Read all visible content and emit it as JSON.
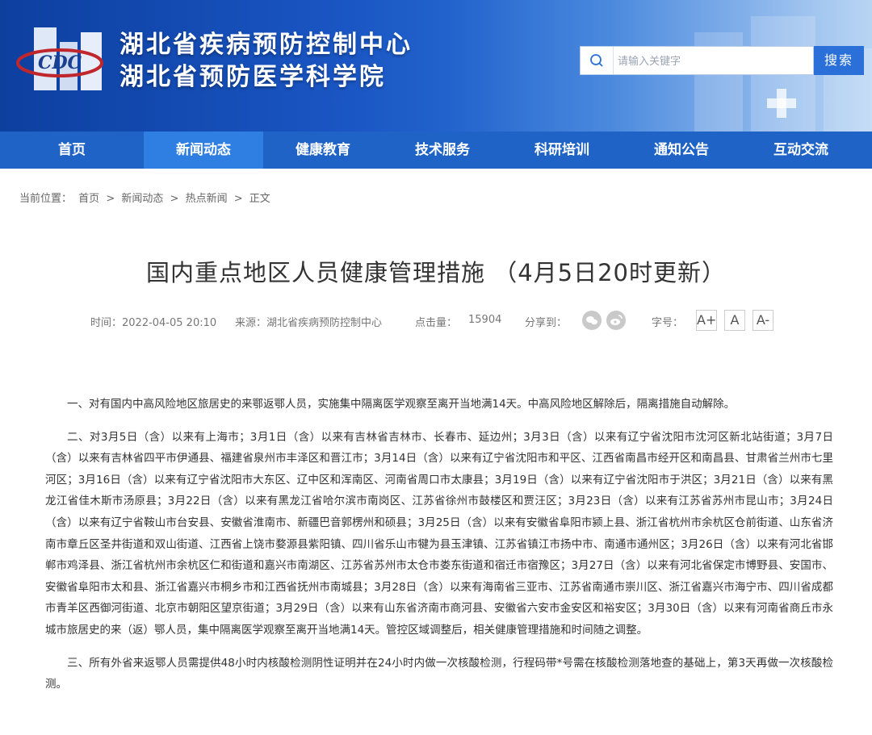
{
  "header": {
    "org_name_1": "湖北省疾病预防控制中心",
    "org_name_2": "湖北省预防医学科学院",
    "logo_text": "CDC"
  },
  "search": {
    "placeholder": "请输入关键字",
    "button": "搜索"
  },
  "nav": [
    {
      "label": "首页"
    },
    {
      "label": "新闻动态",
      "active": true
    },
    {
      "label": "健康教育"
    },
    {
      "label": "技术服务"
    },
    {
      "label": "科研培训"
    },
    {
      "label": "通知公告"
    },
    {
      "label": "互动交流"
    }
  ],
  "breadcrumb": {
    "prefix": "当前位置：",
    "items": [
      "首页",
      ">",
      "新闻动态",
      ">",
      "热点新闻",
      ">",
      "正文"
    ]
  },
  "article": {
    "title": "国内重点地区人员健康管理措施 （4月5日20时更新）",
    "time": "时间：2022-04-05 20:10",
    "source": "来源：湖北省疾病预防控制中心",
    "hits_label": "点击量：",
    "hits": "15904",
    "share_label": "分享到：",
    "font_label": "字号：",
    "font_buttons": [
      "A+",
      "A",
      "A-"
    ],
    "paragraphs": [
      "一、对有国内中高风险地区旅居史的来鄂返鄂人员，实施集中隔离医学观察至离开当地满14天。中高风险地区解除后，隔离措施自动解除。",
      "二、对3月5日（含）以来有上海市；3月1日（含）以来有吉林省吉林市、长春市、延边州；3月3日（含）以来有辽宁省沈阳市沈河区新北站街道；3月7日（含）以来有吉林省四平市伊通县、福建省泉州市丰泽区和晋江市；3月14日（含）以来有辽宁省沈阳市和平区、江西省南昌市经开区和南昌县、甘肃省兰州市七里河区；3月16日（含）以来有辽宁省沈阳市大东区、辽中区和浑南区、河南省周口市太康县；3月19日（含）以来有辽宁省沈阳市于洪区；3月21日（含）以来有黑龙江省佳木斯市汤原县；3月22日（含）以来有黑龙江省哈尔滨市南岗区、江苏省徐州市鼓楼区和贾汪区；3月23日（含）以来有江苏省苏州市昆山市；3月24日（含）以来有辽宁省鞍山市台安县、安徽省淮南市、新疆巴音郭楞州和硕县；3月25日（含）以来有安徽省阜阳市颍上县、浙江省杭州市余杭区仓前街道、山东省济南市章丘区圣井街道和双山街道、江西省上饶市婺源县紫阳镇、四川省乐山市犍为县玉津镇、江苏省镇江市扬中市、南通市通州区；3月26日（含）以来有河北省邯郸市鸡泽县、浙江省杭州市余杭区仁和街道和嘉兴市南湖区、江苏省苏州市太仓市娄东街道和宿迁市宿豫区；3月27日（含）以来有河北省保定市博野县、安国市、安徽省阜阳市太和县、浙江省嘉兴市桐乡市和江西省抚州市南城县；3月28日（含）以来有海南省三亚市、江苏省南通市崇川区、浙江省嘉兴市海宁市、四川省成都市青羊区西御河街道、北京市朝阳区望京街道；3月29日（含）以来有山东省济南市商河县、安徽省六安市金安区和裕安区；3月30日（含）以来有河南省商丘市永城市旅居史的来（返）鄂人员，集中隔离医学观察至离开当地满14天。管控区域调整后，相关健康管理措施和时间随之调整。",
      "三、所有外省来返鄂人员需提供48小时内核酸检测阴性证明并在24小时内做一次核酸检测，行程码带*号需在核酸检测落地查的基础上，第3天再做一次核酸检测。"
    ]
  },
  "colors": {
    "header_dark": "#0d3f9f",
    "nav": "#1f63c6",
    "nav_active": "#2f7ee2",
    "search_button": "#2a70d8"
  }
}
